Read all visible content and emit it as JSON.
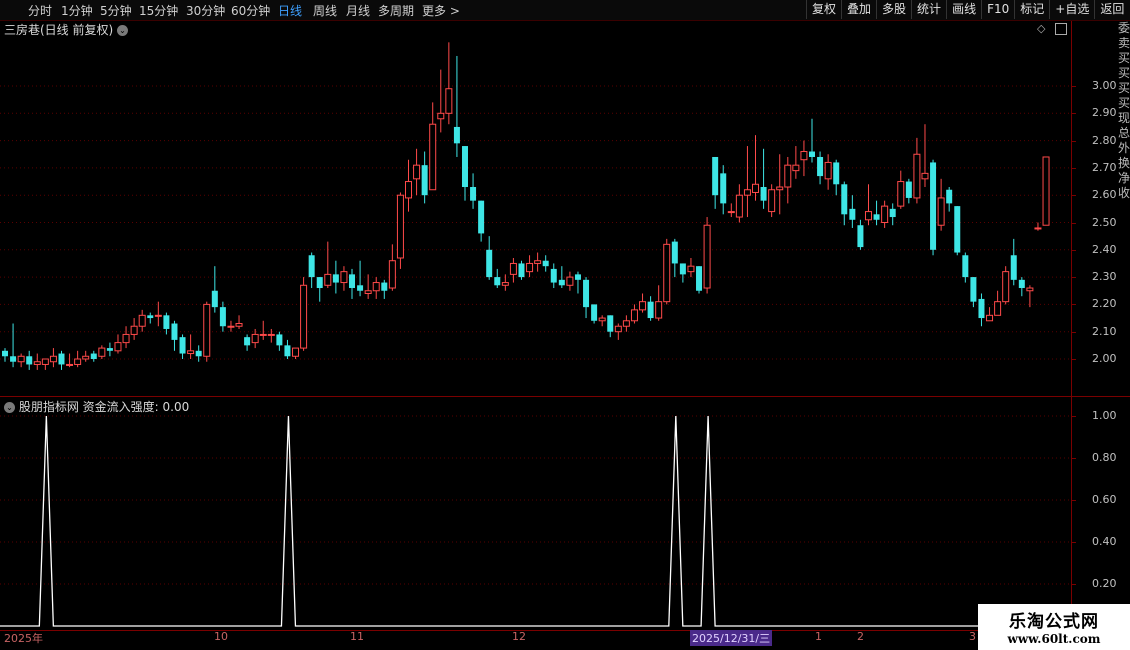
{
  "toolbar": {
    "periods": [
      "分时",
      "1分钟",
      "5分钟",
      "15分钟",
      "30分钟",
      "60分钟",
      "日线",
      "周线",
      "月线",
      "多周期",
      "更多 >"
    ],
    "active_period": "日线",
    "buttons": [
      "复权",
      "叠加",
      "多股",
      "统计",
      "画线",
      "F10",
      "标记",
      "+自选",
      "返回"
    ]
  },
  "main_chart": {
    "title": "三房巷(日线 前复权)",
    "y_labels": [
      "3.00",
      "2.90",
      "2.80",
      "2.70",
      "2.60",
      "2.50",
      "2.40",
      "2.30",
      "2.20",
      "2.10",
      "2.00"
    ],
    "up_color": "#ff4a4a",
    "down_color": "#3ee6e6",
    "candles": [
      [
        2.03,
        2.01,
        2.04,
        1.99
      ],
      [
        2.01,
        1.99,
        2.13,
        1.97
      ],
      [
        1.99,
        2.01,
        2.02,
        1.97
      ],
      [
        2.01,
        1.98,
        2.03,
        1.96
      ],
      [
        1.98,
        1.99,
        2.02,
        1.96
      ],
      [
        1.98,
        2.0,
        2.0,
        1.96
      ],
      [
        1.99,
        2.01,
        2.04,
        1.97
      ],
      [
        2.02,
        1.98,
        2.03,
        1.96
      ],
      [
        1.98,
        1.98,
        2.02,
        1.97
      ],
      [
        1.98,
        2.0,
        2.03,
        1.97
      ],
      [
        2.0,
        2.01,
        2.03,
        1.99
      ],
      [
        2.02,
        2.0,
        2.03,
        1.99
      ],
      [
        2.01,
        2.04,
        2.05,
        2.0
      ],
      [
        2.04,
        2.03,
        2.06,
        2.01
      ],
      [
        2.03,
        2.06,
        2.09,
        2.02
      ],
      [
        2.06,
        2.09,
        2.12,
        2.04
      ],
      [
        2.09,
        2.12,
        2.15,
        2.07
      ],
      [
        2.12,
        2.16,
        2.18,
        2.1
      ],
      [
        2.16,
        2.15,
        2.17,
        2.13
      ],
      [
        2.16,
        2.16,
        2.21,
        2.12
      ],
      [
        2.16,
        2.11,
        2.17,
        2.09
      ],
      [
        2.13,
        2.07,
        2.14,
        2.03
      ],
      [
        2.08,
        2.02,
        2.09,
        2.0
      ],
      [
        2.02,
        2.03,
        2.09,
        2.0
      ],
      [
        2.03,
        2.01,
        2.05,
        1.99
      ],
      [
        2.01,
        2.2,
        2.21,
        1.99
      ],
      [
        2.25,
        2.19,
        2.34,
        2.17
      ],
      [
        2.19,
        2.12,
        2.21,
        2.1
      ],
      [
        2.12,
        2.12,
        2.14,
        2.1
      ],
      [
        2.12,
        2.13,
        2.16,
        2.11
      ],
      [
        2.08,
        2.05,
        2.09,
        2.03
      ],
      [
        2.06,
        2.09,
        2.11,
        2.04
      ],
      [
        2.09,
        2.09,
        2.14,
        2.07
      ],
      [
        2.09,
        2.09,
        2.11,
        2.06
      ],
      [
        2.09,
        2.05,
        2.1,
        2.03
      ],
      [
        2.05,
        2.01,
        2.07,
        2.0
      ],
      [
        2.01,
        2.04,
        2.04,
        2.0
      ],
      [
        2.04,
        2.27,
        2.3,
        2.03
      ],
      [
        2.38,
        2.3,
        2.39,
        2.26
      ],
      [
        2.3,
        2.26,
        2.3,
        2.21
      ],
      [
        2.27,
        2.31,
        2.43,
        2.26
      ],
      [
        2.31,
        2.28,
        2.36,
        2.24
      ],
      [
        2.28,
        2.32,
        2.34,
        2.25
      ],
      [
        2.31,
        2.26,
        2.33,
        2.22
      ],
      [
        2.27,
        2.25,
        2.36,
        2.23
      ],
      [
        2.24,
        2.25,
        2.31,
        2.22
      ],
      [
        2.25,
        2.28,
        2.3,
        2.22
      ],
      [
        2.28,
        2.25,
        2.29,
        2.22
      ],
      [
        2.26,
        2.36,
        2.42,
        2.25
      ],
      [
        2.37,
        2.6,
        2.61,
        2.33
      ],
      [
        2.59,
        2.65,
        2.73,
        2.54
      ],
      [
        2.66,
        2.71,
        2.77,
        2.6
      ],
      [
        2.71,
        2.6,
        2.76,
        2.57
      ],
      [
        2.62,
        2.86,
        2.94,
        2.62
      ],
      [
        2.88,
        2.9,
        3.06,
        2.83
      ],
      [
        2.9,
        2.99,
        3.16,
        2.86
      ],
      [
        2.85,
        2.79,
        3.11,
        2.74
      ],
      [
        2.78,
        2.63,
        2.78,
        2.58
      ],
      [
        2.63,
        2.58,
        2.68,
        2.55
      ],
      [
        2.58,
        2.46,
        2.58,
        2.43
      ],
      [
        2.4,
        2.3,
        2.45,
        2.29
      ],
      [
        2.3,
        2.27,
        2.33,
        2.26
      ],
      [
        2.27,
        2.28,
        2.31,
        2.25
      ],
      [
        2.31,
        2.35,
        2.37,
        2.28
      ],
      [
        2.35,
        2.3,
        2.36,
        2.29
      ],
      [
        2.32,
        2.35,
        2.38,
        2.3
      ],
      [
        2.35,
        2.36,
        2.39,
        2.32
      ],
      [
        2.36,
        2.34,
        2.38,
        2.32
      ],
      [
        2.33,
        2.28,
        2.35,
        2.26
      ],
      [
        2.29,
        2.27,
        2.34,
        2.26
      ],
      [
        2.27,
        2.3,
        2.32,
        2.25
      ],
      [
        2.31,
        2.29,
        2.32,
        2.24
      ],
      [
        2.29,
        2.19,
        2.3,
        2.15
      ],
      [
        2.2,
        2.14,
        2.2,
        2.13
      ],
      [
        2.14,
        2.15,
        2.16,
        2.12
      ],
      [
        2.16,
        2.1,
        2.16,
        2.08
      ],
      [
        2.1,
        2.12,
        2.13,
        2.07
      ],
      [
        2.12,
        2.14,
        2.16,
        2.1
      ],
      [
        2.14,
        2.18,
        2.2,
        2.13
      ],
      [
        2.18,
        2.21,
        2.24,
        2.17
      ],
      [
        2.21,
        2.15,
        2.23,
        2.14
      ],
      [
        2.15,
        2.21,
        2.27,
        2.14
      ],
      [
        2.21,
        2.42,
        2.44,
        2.2
      ],
      [
        2.43,
        2.35,
        2.44,
        2.3
      ],
      [
        2.35,
        2.31,
        2.35,
        2.28
      ],
      [
        2.32,
        2.34,
        2.37,
        2.3
      ],
      [
        2.34,
        2.25,
        2.34,
        2.24
      ],
      [
        2.26,
        2.49,
        2.52,
        2.24
      ],
      [
        2.74,
        2.6,
        2.74,
        2.55
      ],
      [
        2.68,
        2.57,
        2.71,
        2.53
      ],
      [
        2.54,
        2.54,
        2.57,
        2.52
      ],
      [
        2.52,
        2.6,
        2.64,
        2.5
      ],
      [
        2.6,
        2.62,
        2.78,
        2.52
      ],
      [
        2.61,
        2.64,
        2.82,
        2.58
      ],
      [
        2.63,
        2.58,
        2.77,
        2.55
      ],
      [
        2.54,
        2.62,
        2.64,
        2.52
      ],
      [
        2.62,
        2.63,
        2.75,
        2.53
      ],
      [
        2.63,
        2.71,
        2.74,
        2.57
      ],
      [
        2.69,
        2.71,
        2.78,
        2.66
      ],
      [
        2.73,
        2.76,
        2.8,
        2.67
      ],
      [
        2.76,
        2.74,
        2.88,
        2.72
      ],
      [
        2.74,
        2.67,
        2.76,
        2.64
      ],
      [
        2.66,
        2.72,
        2.75,
        2.62
      ],
      [
        2.72,
        2.64,
        2.73,
        2.6
      ],
      [
        2.64,
        2.53,
        2.65,
        2.49
      ],
      [
        2.55,
        2.51,
        2.6,
        2.48
      ],
      [
        2.49,
        2.41,
        2.51,
        2.4
      ],
      [
        2.51,
        2.54,
        2.64,
        2.49
      ],
      [
        2.53,
        2.51,
        2.58,
        2.49
      ],
      [
        2.5,
        2.56,
        2.58,
        2.48
      ],
      [
        2.55,
        2.52,
        2.57,
        2.49
      ],
      [
        2.56,
        2.65,
        2.69,
        2.55
      ],
      [
        2.65,
        2.59,
        2.66,
        2.57
      ],
      [
        2.59,
        2.75,
        2.81,
        2.57
      ],
      [
        2.66,
        2.68,
        2.86,
        2.63
      ],
      [
        2.72,
        2.4,
        2.73,
        2.38
      ],
      [
        2.49,
        2.59,
        2.66,
        2.47
      ],
      [
        2.62,
        2.57,
        2.63,
        2.54
      ],
      [
        2.56,
        2.39,
        2.56,
        2.38
      ],
      [
        2.38,
        2.3,
        2.39,
        2.28
      ],
      [
        2.3,
        2.21,
        2.3,
        2.19
      ],
      [
        2.22,
        2.15,
        2.24,
        2.12
      ],
      [
        2.14,
        2.16,
        2.19,
        2.14
      ],
      [
        2.16,
        2.21,
        2.25,
        2.16
      ],
      [
        2.21,
        2.32,
        2.34,
        2.2
      ],
      [
        2.38,
        2.29,
        2.44,
        2.27
      ],
      [
        2.29,
        2.26,
        2.3,
        2.23
      ],
      [
        2.25,
        2.26,
        2.27,
        2.19
      ],
      [
        2.48,
        2.48,
        2.5,
        2.47
      ],
      [
        2.49,
        2.74,
        2.74,
        2.49
      ]
    ]
  },
  "indicator": {
    "title": "股朋指标网 资金流入强度: 0.00",
    "y_labels": [
      "1.00",
      "0.80",
      "0.60",
      "0.40",
      "0.20"
    ],
    "spikes": [
      5,
      35,
      83,
      87
    ],
    "line_color": "#ffffff"
  },
  "date_axis": {
    "labels": [
      "2025年",
      "10",
      "11",
      "12",
      "2025/12/31/三",
      "1",
      "2",
      "3"
    ]
  },
  "watermark": {
    "line1": "乐淘公式网",
    "line2": "www.60lt.com"
  },
  "right_strip_text": "委卖买买买买现总外换净收"
}
